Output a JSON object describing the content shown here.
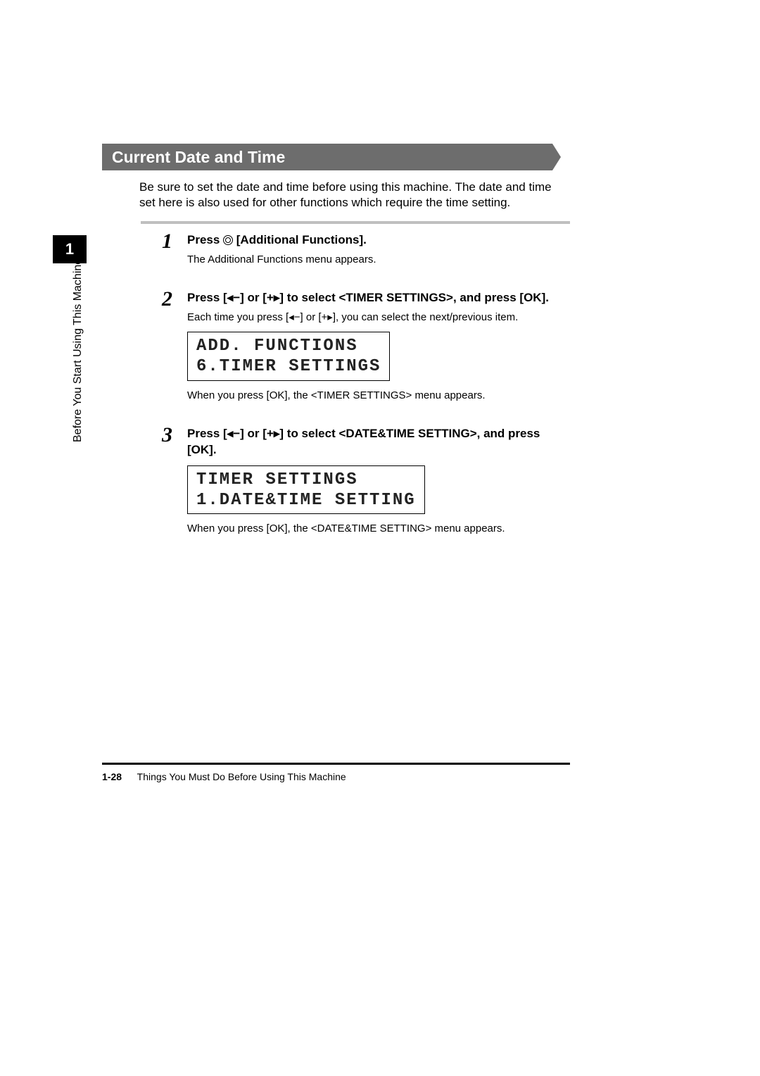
{
  "heading": "Current Date and Time",
  "intro": "Be sure to set the date and time before using this machine. The date and time set here is also used for other functions which require the time setting.",
  "side_tab": "1",
  "side_vertical": "Before You Start Using This Machine",
  "steps": [
    {
      "num": "1",
      "title_before_icon": "Press ",
      "title_after_icon": " [Additional Functions].",
      "body": "The Additional Functions menu appears."
    },
    {
      "num": "2",
      "title": "Press [◂−] or [+▸] to select <TIMER SETTINGS>, and press [OK].",
      "body": "Each time you press [◂−] or [+▸], you can select the next/previous item.",
      "lcd_line1": "ADD. FUNCTIONS",
      "lcd_line2": " 6.TIMER SETTINGS",
      "post": "When you press [OK], the <TIMER SETTINGS> menu appears."
    },
    {
      "num": "3",
      "title": "Press [◂−] or [+▸] to select <DATE&TIME SETTING>, and press [OK].",
      "lcd_line1": "TIMER SETTINGS",
      "lcd_line2": " 1.DATE&TIME SETTING",
      "post": "When you press [OK], the <DATE&TIME SETTING> menu appears."
    }
  ],
  "footer": {
    "page": "1-28",
    "text": "Things You Must Do Before Using This Machine"
  }
}
